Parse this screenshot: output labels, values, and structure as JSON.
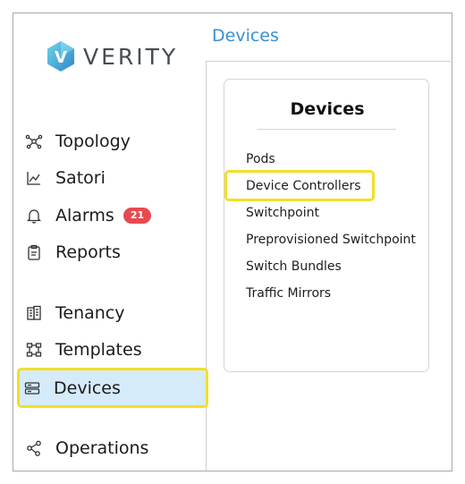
{
  "brand": {
    "logo_text": "VERITY",
    "logo_letter": "V"
  },
  "header": {
    "title": "Devices"
  },
  "sidebar": {
    "items": [
      {
        "label": "Topology",
        "icon": "topology-icon"
      },
      {
        "label": "Satori",
        "icon": "chart-icon"
      },
      {
        "label": "Alarms",
        "icon": "bell-icon",
        "badge": "21"
      },
      {
        "label": "Reports",
        "icon": "clipboard-icon"
      },
      {
        "label": "Tenancy",
        "icon": "building-icon"
      },
      {
        "label": "Templates",
        "icon": "template-icon"
      },
      {
        "label": "Devices",
        "icon": "server-icon",
        "active": true
      },
      {
        "label": "Operations",
        "icon": "share-icon"
      }
    ]
  },
  "devices_card": {
    "title": "Devices",
    "items": [
      "Pods",
      "Device Controllers",
      "Switchpoint",
      "Preprovisioned Switchpoint",
      "Switch Bundles",
      "Traffic Mirrors"
    ],
    "highlighted": "Device Controllers"
  },
  "colors": {
    "accent_blue": "#3b8fd0",
    "highlight_yellow": "#f2df27",
    "active_bg": "#d6ebfa",
    "badge_red": "#e8494f"
  }
}
